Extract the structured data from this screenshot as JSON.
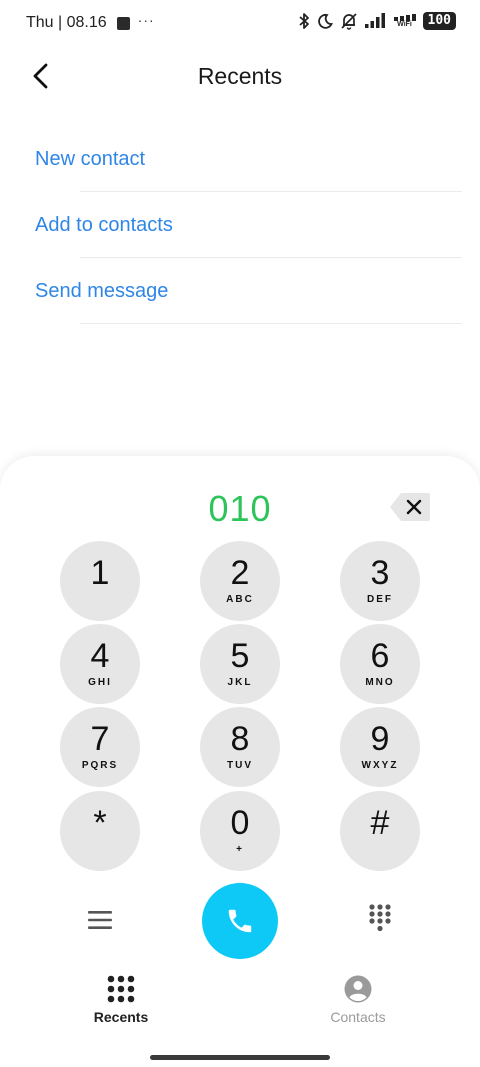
{
  "status_bar": {
    "time": "Thu | 08.16",
    "overflow": "···",
    "wifi_label": "WiFi",
    "battery": "100",
    "icons": [
      "bluetooth-icon",
      "moon-icon",
      "bell-muted-icon",
      "signal-icon",
      "wifi-icon",
      "battery-icon"
    ]
  },
  "header": {
    "title": "Recents",
    "back_icon": "chevron-left-icon"
  },
  "actions": [
    {
      "label": "New contact"
    },
    {
      "label": "Add to contacts"
    },
    {
      "label": "Send message"
    }
  ],
  "dialer": {
    "number": "010",
    "backspace_icon": "backspace-icon",
    "keys": [
      {
        "digit": "1",
        "letters": ""
      },
      {
        "digit": "2",
        "letters": "ABC"
      },
      {
        "digit": "3",
        "letters": "DEF"
      },
      {
        "digit": "4",
        "letters": "GHI"
      },
      {
        "digit": "5",
        "letters": "JKL"
      },
      {
        "digit": "6",
        "letters": "MNO"
      },
      {
        "digit": "7",
        "letters": "PQRS"
      },
      {
        "digit": "8",
        "letters": "TUV"
      },
      {
        "digit": "9",
        "letters": "WXYZ"
      },
      {
        "digit": "*",
        "letters": ""
      },
      {
        "digit": "0",
        "letters": "+"
      },
      {
        "digit": "#",
        "letters": ""
      }
    ],
    "tools": [
      "menu-icon",
      "phone-call-icon",
      "keypad-icon"
    ]
  },
  "bottom_nav": {
    "tabs": [
      {
        "label": "Recents",
        "icon": "keypad-grid-icon",
        "active": true
      },
      {
        "label": "Contacts",
        "icon": "person-circle-icon",
        "active": false
      }
    ]
  },
  "colors": {
    "accent_link": "#2f86e6",
    "dialed_number": "#2ec45a",
    "call_button": "#0ec9f5",
    "key_background": "#e6e6e6",
    "inactive_tab": "#9a9a9a"
  }
}
